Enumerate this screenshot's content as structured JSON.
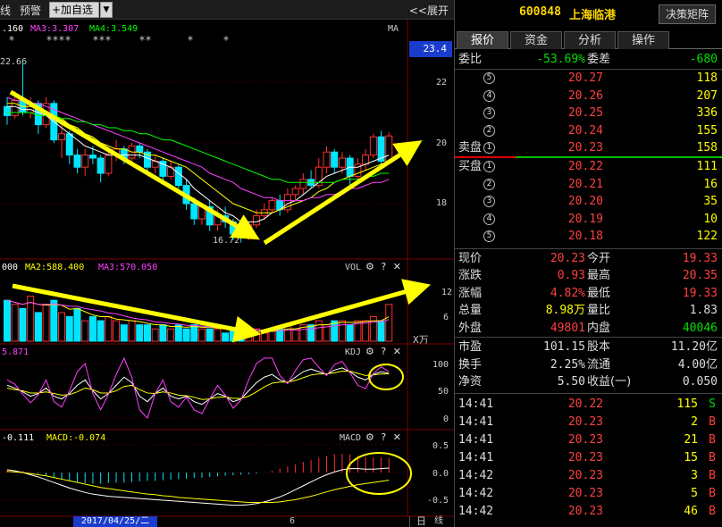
{
  "toolbar": {
    "left_label": "线",
    "alert_label": "预警",
    "add_watch_label": "+加自选",
    "dropdown_glyph": "▼",
    "expand_label": "<<展开"
  },
  "main_chart": {
    "ma_labels": [
      {
        "text": ".160",
        "color": "#ffffff"
      },
      {
        "text": "MA3:3.307",
        "color": "#ff40ff"
      },
      {
        "text": "MA4:3.549",
        "color": "#00ff00"
      }
    ],
    "ma_tag": "MA",
    "stars": [
      "*",
      "****",
      "***",
      "**",
      "*",
      "*"
    ],
    "high_label": "22.66",
    "low_label": "16.72",
    "current_price_box": "23.4",
    "y_axis": [
      "22",
      "20",
      "18"
    ],
    "candles": [
      {
        "o": 21.2,
        "c": 20.9,
        "h": 21.5,
        "l": 20.6
      },
      {
        "o": 20.9,
        "c": 21.4,
        "h": 21.7,
        "l": 20.8
      },
      {
        "o": 21.4,
        "c": 21.0,
        "h": 22.66,
        "l": 20.9
      },
      {
        "o": 21.0,
        "c": 21.3,
        "h": 21.5,
        "l": 20.8
      },
      {
        "o": 21.3,
        "c": 20.6,
        "h": 21.4,
        "l": 20.3
      },
      {
        "o": 20.6,
        "c": 21.3,
        "h": 21.5,
        "l": 20.5
      },
      {
        "o": 21.3,
        "c": 20.1,
        "h": 21.4,
        "l": 20.0
      },
      {
        "o": 20.1,
        "c": 20.3,
        "h": 20.6,
        "l": 19.5
      },
      {
        "o": 20.3,
        "c": 19.6,
        "h": 20.4,
        "l": 19.3
      },
      {
        "o": 19.6,
        "c": 19.2,
        "h": 19.8,
        "l": 19.0
      },
      {
        "o": 19.2,
        "c": 19.6,
        "h": 19.8,
        "l": 18.9
      },
      {
        "o": 19.6,
        "c": 19.5,
        "h": 19.9,
        "l": 19.3
      },
      {
        "o": 19.5,
        "c": 19.0,
        "h": 19.6,
        "l": 18.7
      },
      {
        "o": 19.0,
        "c": 19.6,
        "h": 19.8,
        "l": 18.9
      },
      {
        "o": 19.6,
        "c": 19.8,
        "h": 20.1,
        "l": 19.4
      },
      {
        "o": 19.8,
        "c": 19.5,
        "h": 19.9,
        "l": 19.3
      },
      {
        "o": 19.5,
        "c": 19.9,
        "h": 20.0,
        "l": 19.4
      },
      {
        "o": 19.9,
        "c": 19.7,
        "h": 20.0,
        "l": 19.5
      },
      {
        "o": 19.7,
        "c": 19.2,
        "h": 19.8,
        "l": 19.0
      },
      {
        "o": 19.2,
        "c": 19.4,
        "h": 19.6,
        "l": 19.0
      },
      {
        "o": 19.4,
        "c": 18.9,
        "h": 19.5,
        "l": 18.7
      },
      {
        "o": 18.9,
        "c": 19.2,
        "h": 19.4,
        "l": 18.8
      },
      {
        "o": 19.2,
        "c": 18.6,
        "h": 19.3,
        "l": 18.5
      },
      {
        "o": 18.6,
        "c": 18.0,
        "h": 18.8,
        "l": 17.8
      },
      {
        "o": 18.0,
        "c": 17.5,
        "h": 18.2,
        "l": 17.3
      },
      {
        "o": 17.5,
        "c": 17.9,
        "h": 18.0,
        "l": 17.3
      },
      {
        "o": 17.9,
        "c": 17.3,
        "h": 18.1,
        "l": 17.1
      },
      {
        "o": 17.3,
        "c": 17.6,
        "h": 17.8,
        "l": 17.1
      },
      {
        "o": 17.6,
        "c": 17.4,
        "h": 17.9,
        "l": 17.2
      },
      {
        "o": 17.4,
        "c": 17.0,
        "h": 17.5,
        "l": 16.8
      },
      {
        "o": 17.0,
        "c": 16.9,
        "h": 17.2,
        "l": 16.72
      },
      {
        "o": 16.9,
        "c": 17.3,
        "h": 17.4,
        "l": 16.8
      },
      {
        "o": 17.3,
        "c": 17.6,
        "h": 17.8,
        "l": 17.2
      },
      {
        "o": 17.6,
        "c": 17.8,
        "h": 18.0,
        "l": 17.5
      },
      {
        "o": 17.8,
        "c": 18.1,
        "h": 18.2,
        "l": 17.7
      },
      {
        "o": 18.1,
        "c": 17.8,
        "h": 18.3,
        "l": 17.6
      },
      {
        "o": 17.8,
        "c": 18.3,
        "h": 18.5,
        "l": 17.7
      },
      {
        "o": 18.3,
        "c": 18.5,
        "h": 18.6,
        "l": 18.1
      },
      {
        "o": 18.5,
        "c": 18.8,
        "h": 19.0,
        "l": 18.3
      },
      {
        "o": 18.8,
        "c": 18.6,
        "h": 19.1,
        "l": 18.5
      },
      {
        "o": 18.6,
        "c": 19.2,
        "h": 19.5,
        "l": 18.5
      },
      {
        "o": 19.2,
        "c": 19.7,
        "h": 19.9,
        "l": 19.0
      },
      {
        "o": 19.7,
        "c": 19.2,
        "h": 19.8,
        "l": 19.0
      },
      {
        "o": 19.2,
        "c": 19.5,
        "h": 19.7,
        "l": 19.0
      },
      {
        "o": 19.5,
        "c": 18.9,
        "h": 19.6,
        "l": 18.6
      },
      {
        "o": 18.9,
        "c": 19.3,
        "h": 19.5,
        "l": 18.7
      },
      {
        "o": 19.3,
        "c": 19.6,
        "h": 19.8,
        "l": 19.1
      },
      {
        "o": 19.6,
        "c": 20.2,
        "h": 20.3,
        "l": 19.5
      },
      {
        "o": 20.2,
        "c": 19.4,
        "h": 20.4,
        "l": 19.3
      },
      {
        "o": 19.4,
        "c": 20.23,
        "h": 20.35,
        "l": 19.33
      }
    ],
    "ma_lines": [
      {
        "name": "ma-white",
        "color": "#ffffff",
        "values": [
          21.2,
          21.2,
          21.1,
          21.1,
          21.0,
          20.9,
          20.7,
          20.5,
          20.3,
          20.1,
          19.9,
          19.8,
          19.7,
          19.6,
          19.6,
          19.6,
          19.6,
          19.6,
          19.5,
          19.4,
          19.3,
          19.2,
          19.0,
          18.8,
          18.5,
          18.3,
          18.1,
          17.9,
          17.7,
          17.6,
          17.4,
          17.4,
          17.4,
          17.5,
          17.7,
          17.8,
          18.0,
          18.1,
          18.3,
          18.5,
          18.7,
          18.9,
          19.0,
          19.1,
          19.2,
          19.2,
          19.3,
          19.4,
          19.5,
          19.6
        ]
      },
      {
        "name": "ma-yellow",
        "color": "#ffff00",
        "values": [
          21.3,
          21.3,
          21.2,
          21.2,
          21.1,
          21.0,
          20.9,
          20.8,
          20.6,
          20.5,
          20.3,
          20.2,
          20.0,
          19.9,
          19.8,
          19.8,
          19.7,
          19.7,
          19.6,
          19.6,
          19.5,
          19.4,
          19.3,
          19.2,
          19.0,
          18.8,
          18.6,
          18.4,
          18.2,
          18.0,
          17.9,
          17.8,
          17.7,
          17.7,
          17.7,
          17.8,
          17.9,
          18.0,
          18.1,
          18.2,
          18.4,
          18.5,
          18.7,
          18.8,
          18.9,
          19.0,
          19.1,
          19.2,
          19.3,
          19.4
        ]
      },
      {
        "name": "ma-magenta",
        "color": "#ff40ff",
        "values": [
          21.5,
          21.4,
          21.4,
          21.3,
          21.3,
          21.2,
          21.1,
          21.0,
          20.9,
          20.8,
          20.7,
          20.6,
          20.5,
          20.4,
          20.3,
          20.2,
          20.1,
          20.0,
          19.9,
          19.8,
          19.7,
          19.6,
          19.5,
          19.4,
          19.3,
          19.2,
          19.0,
          18.9,
          18.8,
          18.7,
          18.5,
          18.4,
          18.3,
          18.2,
          18.2,
          18.1,
          18.1,
          18.1,
          18.1,
          18.2,
          18.2,
          18.3,
          18.3,
          18.4,
          18.5,
          18.5,
          18.6,
          18.7,
          18.7,
          18.8
        ]
      },
      {
        "name": "ma-green",
        "color": "#00ff00",
        "values": [
          21.0,
          21.0,
          21.0,
          21.0,
          20.9,
          20.9,
          20.9,
          20.8,
          20.8,
          20.7,
          20.7,
          20.6,
          20.6,
          20.5,
          20.5,
          20.4,
          20.4,
          20.3,
          20.3,
          20.2,
          20.1,
          20.1,
          20.0,
          19.9,
          19.8,
          19.7,
          19.6,
          19.5,
          19.4,
          19.3,
          19.2,
          19.1,
          19.0,
          18.9,
          18.8,
          18.8,
          18.7,
          18.7,
          18.7,
          18.7,
          18.7,
          18.7,
          18.7,
          18.8,
          18.8,
          18.8,
          18.9,
          18.9,
          19.0,
          19.0
        ]
      }
    ]
  },
  "vol_panel": {
    "labels": [
      {
        "text": "000",
        "color": "#ffffff"
      },
      {
        "text": "MA2:588.400",
        "color": "#ffff00"
      },
      {
        "text": "MA3:570.050",
        "color": "#ff40ff"
      }
    ],
    "tag": "VOL",
    "y_axis": [
      "12",
      "6"
    ],
    "unit": "X万",
    "volumes": [
      10,
      9,
      8,
      11,
      7,
      9,
      10,
      7,
      6,
      8,
      5,
      6,
      5,
      6,
      5,
      4,
      5,
      4,
      4,
      3,
      4,
      3,
      4,
      3,
      4,
      3,
      3,
      3,
      2,
      3,
      2,
      2,
      3,
      2,
      3,
      3,
      4,
      3,
      4,
      4,
      5,
      4,
      5,
      5,
      4,
      5,
      5,
      6,
      5,
      8.98
    ]
  },
  "kdj_panel": {
    "label": "5.871",
    "tag": "KDJ",
    "y_axis": [
      "100",
      "50",
      "0"
    ],
    "k": [
      60,
      55,
      48,
      40,
      45,
      55,
      40,
      35,
      45,
      60,
      70,
      50,
      35,
      45,
      60,
      75,
      65,
      40,
      30,
      45,
      55,
      40,
      35,
      40,
      30,
      25,
      35,
      45,
      40,
      30,
      35,
      50,
      65,
      75,
      80,
      70,
      65,
      75,
      85,
      90,
      85,
      80,
      88,
      92,
      85,
      75,
      70,
      80,
      85,
      82
    ],
    "d": [
      55,
      52,
      50,
      46,
      46,
      48,
      45,
      42,
      43,
      48,
      55,
      52,
      46,
      46,
      50,
      58,
      60,
      52,
      46,
      45,
      48,
      46,
      42,
      41,
      38,
      34,
      35,
      38,
      39,
      36,
      36,
      40,
      48,
      57,
      64,
      66,
      66,
      69,
      74,
      79,
      81,
      81,
      83,
      86,
      86,
      82,
      78,
      79,
      81,
      81
    ],
    "j": [
      70,
      62,
      44,
      28,
      43,
      70,
      30,
      20,
      50,
      85,
      100,
      45,
      15,
      44,
      80,
      110,
      75,
      15,
      0,
      45,
      70,
      30,
      20,
      38,
      15,
      8,
      35,
      60,
      42,
      18,
      33,
      70,
      100,
      110,
      112,
      78,
      63,
      87,
      107,
      112,
      93,
      78,
      98,
      104,
      83,
      60,
      54,
      82,
      94,
      85
    ]
  },
  "macd_panel": {
    "labels": [
      {
        "text": "-0.111",
        "color": "#ffffff"
      },
      {
        "text": "MACD:-0.074",
        "color": "#ffff00"
      }
    ],
    "tag": "MACD",
    "y_axis": [
      "0.5",
      "0.0",
      "-0.5"
    ],
    "macd": [
      0.05,
      0.04,
      0.03,
      0.01,
      -0.02,
      -0.05,
      -0.08,
      -0.12,
      -0.15,
      -0.17,
      -0.19,
      -0.2,
      -0.2,
      -0.19,
      -0.18,
      -0.18,
      -0.17,
      -0.16,
      -0.15,
      -0.15,
      -0.14,
      -0.13,
      -0.12,
      -0.11,
      -0.1,
      -0.09,
      -0.08,
      -0.07,
      -0.06,
      -0.05,
      -0.04,
      -0.03,
      -0.02,
      0.0,
      0.03,
      0.07,
      0.11,
      0.15,
      0.19,
      0.23,
      0.27,
      0.3,
      0.33,
      0.34,
      0.33,
      0.3,
      0.28,
      0.27,
      0.27,
      0.26
    ],
    "dif": [
      0.05,
      0.03,
      0.0,
      -0.04,
      -0.08,
      -0.13,
      -0.18,
      -0.23,
      -0.28,
      -0.32,
      -0.36,
      -0.39,
      -0.41,
      -0.43,
      -0.44,
      -0.45,
      -0.46,
      -0.47,
      -0.48,
      -0.49,
      -0.5,
      -0.51,
      -0.52,
      -0.53,
      -0.54,
      -0.55,
      -0.56,
      -0.57,
      -0.58,
      -0.59,
      -0.59,
      -0.58,
      -0.56,
      -0.53,
      -0.49,
      -0.44,
      -0.38,
      -0.31,
      -0.24,
      -0.17,
      -0.1,
      -0.04,
      0.01,
      0.05,
      0.07,
      0.07,
      0.06,
      0.06,
      0.07,
      0.08
    ],
    "dea": [
      0.02,
      0.01,
      0.0,
      -0.02,
      -0.04,
      -0.06,
      -0.09,
      -0.12,
      -0.15,
      -0.18,
      -0.21,
      -0.24,
      -0.27,
      -0.29,
      -0.31,
      -0.33,
      -0.35,
      -0.37,
      -0.39,
      -0.4,
      -0.42,
      -0.43,
      -0.45,
      -0.46,
      -0.47,
      -0.48,
      -0.49,
      -0.5,
      -0.51,
      -0.52,
      -0.53,
      -0.54,
      -0.54,
      -0.54,
      -0.54,
      -0.53,
      -0.51,
      -0.49,
      -0.46,
      -0.43,
      -0.39,
      -0.35,
      -0.31,
      -0.28,
      -0.25,
      -0.22,
      -0.2,
      -0.18,
      -0.16,
      -0.14
    ]
  },
  "bottom": {
    "date": "2017/04/25/二",
    "tick": "6",
    "day_label": "日",
    "scroll_glyph": "线"
  },
  "quote": {
    "code": "600848",
    "name": "上海临港",
    "decision_button": "决策矩阵",
    "tabs": [
      "报价",
      "资金",
      "分析",
      "操作"
    ],
    "weibi_label": "委比",
    "weibi_value": "-53.69%",
    "weicha_label": "委差",
    "weicha_value": "-680",
    "sell_label": "卖盘",
    "buy_label": "买盘",
    "asks": [
      {
        "level": "5",
        "price": "20.27",
        "vol": "118"
      },
      {
        "level": "4",
        "price": "20.26",
        "vol": "207"
      },
      {
        "level": "3",
        "price": "20.25",
        "vol": "336"
      },
      {
        "level": "2",
        "price": "20.24",
        "vol": "155"
      },
      {
        "level": "1",
        "price": "20.23",
        "vol": "158"
      }
    ],
    "bids": [
      {
        "level": "1",
        "price": "20.22",
        "vol": "111"
      },
      {
        "level": "2",
        "price": "20.21",
        "vol": "16"
      },
      {
        "level": "3",
        "price": "20.20",
        "vol": "35"
      },
      {
        "level": "4",
        "price": "20.19",
        "vol": "10"
      },
      {
        "level": "5",
        "price": "20.18",
        "vol": "122"
      }
    ],
    "stats": [
      {
        "l1": "现价",
        "v1": "20.23",
        "c1": "red",
        "l2": "今开",
        "v2": "19.33",
        "c2": "red"
      },
      {
        "l1": "涨跌",
        "v1": "0.93",
        "c1": "red",
        "l2": "最高",
        "v2": "20.35",
        "c2": "red"
      },
      {
        "l1": "涨幅",
        "v1": "4.82%",
        "c1": "red",
        "l2": "最低",
        "v2": "19.33",
        "c2": "red"
      },
      {
        "l1": "总量",
        "v1": "8.98万",
        "c1": "yellow",
        "l2": "量比",
        "v2": "1.83",
        "c2": "white"
      },
      {
        "l1": "外盘",
        "v1": "49801",
        "c1": "red",
        "l2": "内盘",
        "v2": "40046",
        "c2": "green"
      }
    ],
    "fundamentals": [
      {
        "l1": "市盈",
        "v1": "101.15",
        "l2": "股本",
        "v2": "11.20亿"
      },
      {
        "l1": "换手",
        "v1": "2.25%",
        "l2": "流通",
        "v2": "4.00亿"
      },
      {
        "l1": "净资",
        "v1": "5.50",
        "l2": "收益(一)",
        "v2": "0.050"
      }
    ],
    "ticks": [
      {
        "time": "14:41",
        "price": "20.22",
        "vol": "115",
        "side": "S",
        "side_color": "green"
      },
      {
        "time": "14:41",
        "price": "20.23",
        "vol": "2",
        "side": "B",
        "side_color": "red"
      },
      {
        "time": "14:41",
        "price": "20.23",
        "vol": "21",
        "side": "B",
        "side_color": "red"
      },
      {
        "time": "14:41",
        "price": "20.23",
        "vol": "15",
        "side": "B",
        "side_color": "red"
      },
      {
        "time": "14:42",
        "price": "20.23",
        "vol": "3",
        "side": "B",
        "side_color": "red"
      },
      {
        "time": "14:42",
        "price": "20.23",
        "vol": "5",
        "side": "B",
        "side_color": "red"
      },
      {
        "time": "14:42",
        "price": "20.23",
        "vol": "46",
        "side": "B",
        "side_color": "red"
      }
    ]
  },
  "colors": {
    "up": "#ff3030",
    "down": "#00e5ff",
    "annotation": "#ffff00",
    "accent_blue": "#1a3ccc"
  },
  "panel_icons": [
    "gear-icon",
    "help-icon",
    "close-icon"
  ]
}
